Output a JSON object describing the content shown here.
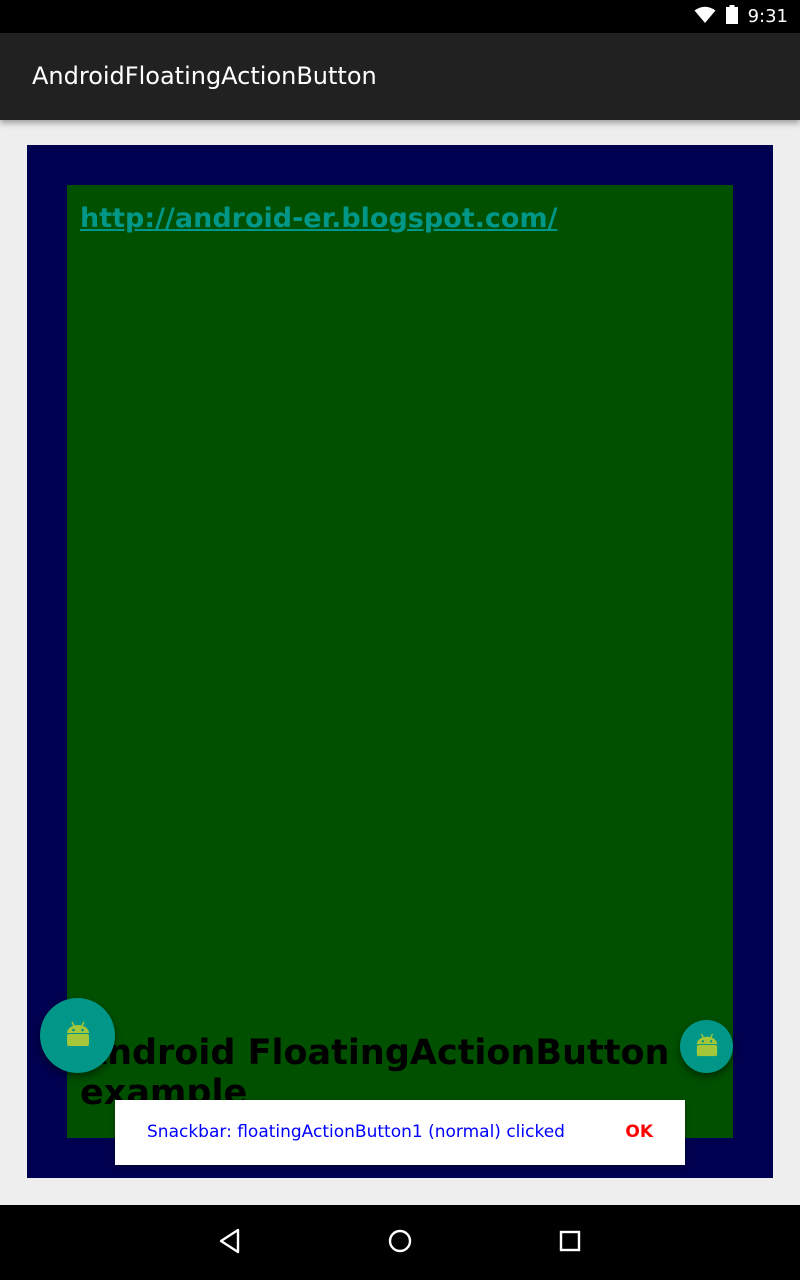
{
  "status_bar": {
    "time": "9:31"
  },
  "app_bar": {
    "title": "AndroidFloatingActionButton"
  },
  "content": {
    "link": "http://android-er.blogspot.com/",
    "headline": "Android FloatingActionButton example"
  },
  "fabs": {
    "normal_icon": "android-robot-icon",
    "mini_icon": "android-robot-icon"
  },
  "snackbar": {
    "message": "Snackbar: floatingActionButton1 (normal) clicked",
    "action": "OK"
  },
  "colors": {
    "outer_frame": "#000050",
    "inner_panel": "#005000",
    "accent": "#009688",
    "snackbar_text": "#0000ff",
    "snackbar_action": "#ff0000"
  }
}
